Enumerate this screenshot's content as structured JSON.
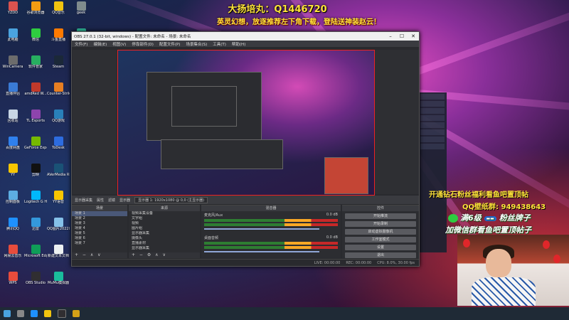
{
  "banner": {
    "top_line": "大扬培丸：Q1446720",
    "second_line": "英灵幻想，放逐推荐左下角下载，登陆送神装赵云！"
  },
  "promo": {
    "line1": "开通钻石粉丝福利看鱼吧置顶帖",
    "line2": "QQ壁纸群: 949438643",
    "line3_prefix": "满6级",
    "line3_badge": "粉丝牌子",
    "line3_suffix": "粉丝牌子",
    "line4": "加微信群看鱼吧置顶帖子"
  },
  "desktop_icons": [
    {
      "label": "YZDD",
      "icon": "app-icon",
      "color": "#d9534f"
    },
    {
      "label": "此电脑",
      "icon": "computer-icon",
      "color": "#4aa3df"
    },
    {
      "label": "WinCamera",
      "icon": "camera-icon",
      "color": "#6c6c6c"
    },
    {
      "label": "直播伴侣",
      "icon": "app-icon",
      "color": "#3a7bd5"
    },
    {
      "label": "回收站",
      "icon": "recycle-bin-icon",
      "color": "#c8d6e5"
    },
    {
      "label": "百度网盘",
      "icon": "cloud-icon",
      "color": "#2f80ed"
    },
    {
      "label": "YY",
      "icon": "app-icon",
      "color": "#f7c600"
    },
    {
      "label": "控制面板",
      "icon": "control-panel-icon",
      "color": "#5dade2"
    },
    {
      "label": "腾讯QQ",
      "icon": "qq-icon",
      "color": "#1e90ff"
    },
    {
      "label": "网易云音乐",
      "icon": "music-icon",
      "color": "#e74c3c"
    },
    {
      "label": "WPS",
      "icon": "app-icon",
      "color": "#e74c3c"
    },
    {
      "label": "谷歌浏览器",
      "icon": "browser-icon",
      "color": "#f39c12"
    },
    {
      "label": "微信",
      "icon": "wechat-icon",
      "color": "#2ecc40"
    },
    {
      "label": "软件管家",
      "icon": "app-icon",
      "color": "#27ae60"
    },
    {
      "label": "amdRed W...",
      "icon": "app-icon",
      "color": "#c0392b"
    },
    {
      "label": "TL Esports",
      "icon": "game-icon",
      "color": "#8e44ad"
    },
    {
      "label": "GeForce Experience",
      "icon": "nvidia-icon",
      "color": "#76b900"
    },
    {
      "label": "剪映",
      "icon": "app-icon",
      "color": "#111111"
    },
    {
      "label": "Logitech G HUB",
      "icon": "logitech-icon",
      "color": "#00b8fc"
    },
    {
      "label": "迅雷",
      "icon": "app-icon",
      "color": "#3498db"
    },
    {
      "label": "Microsoft Edge",
      "icon": "edge-icon",
      "color": "#0f9d58"
    },
    {
      "label": "OBS Studio",
      "icon": "obs-icon",
      "color": "#302e31"
    },
    {
      "label": "QQ音乐",
      "icon": "music-icon",
      "color": "#f1c40f"
    },
    {
      "label": "斗鱼直播",
      "icon": "app-icon",
      "color": "#ff7a00"
    },
    {
      "label": "Steam",
      "icon": "steam-icon",
      "color": "#1b2838"
    },
    {
      "label": "Counter-Strike 2",
      "icon": "game-icon",
      "color": "#e67e22"
    },
    {
      "label": "QQ游戏",
      "icon": "game-icon",
      "color": "#2980b9"
    },
    {
      "label": "ToDesk",
      "icon": "app-icon",
      "color": "#2d6cdf"
    },
    {
      "label": "AVerMedia RECentral 4",
      "icon": "app-icon",
      "color": "#1a5276"
    },
    {
      "label": "YY语音",
      "icon": "app-icon",
      "color": "#f7c600"
    },
    {
      "label": "QQ图片20220419...",
      "icon": "image-icon",
      "color": "#85c1e9"
    },
    {
      "label": "新建文本文档",
      "icon": "text-file-icon",
      "color": "#ecf0f1"
    },
    {
      "label": "MuMu模拟器",
      "icon": "app-icon",
      "color": "#1abc9c"
    },
    {
      "label": "geek",
      "icon": "app-icon",
      "color": "#7f8c8d"
    },
    {
      "label": "streamlabs",
      "icon": "app-icon",
      "color": "#31c3a2"
    }
  ],
  "obs": {
    "title": "OBS 27.0.1 (32-bit, windows) - 配置文件: 未命名 - 场景: 未命名",
    "menu": [
      "文件(F)",
      "编辑(E)",
      "视图(V)",
      "停靠部件(D)",
      "配置文件(P)",
      "场景集合(S)",
      "工具(T)",
      "帮助(H)"
    ],
    "source_label": "显示器采集",
    "toolbar": {
      "props": "属性",
      "filters": "滤镜",
      "display_label": "显示器",
      "display_value": "显示器 1: 1920x1080 @ 0,0 (主显示器)"
    },
    "scenes": {
      "title": "场景",
      "items": [
        "场景 1",
        "场景 2",
        "场景 3",
        "场景 4",
        "场景 5",
        "场景 6",
        "场景 7"
      ]
    },
    "sources": {
      "title": "来源",
      "items": [
        "视频采集设备",
        "文字组",
        "视频",
        "图片组",
        "显示器采集",
        "摄像头",
        "直播素材",
        "显示器采集"
      ]
    },
    "mixer": {
      "title": "混音器",
      "tracks": [
        {
          "name": "麦克风/Aux",
          "db": "0.0 dB"
        },
        {
          "name": "桌面音频",
          "db": "0.0 dB"
        }
      ]
    },
    "controls": {
      "title": "控件",
      "buttons": [
        "开始推流",
        "开始录制",
        "启动虚拟摄像机",
        "工作室模式",
        "设置",
        "退出"
      ]
    },
    "status": {
      "live": "LIVE: 00:00:00",
      "rec": "REC: 00:00:00",
      "cpu": "CPU: 8.0%, 30.00 fps"
    }
  },
  "accent_color": "#ffe43a"
}
